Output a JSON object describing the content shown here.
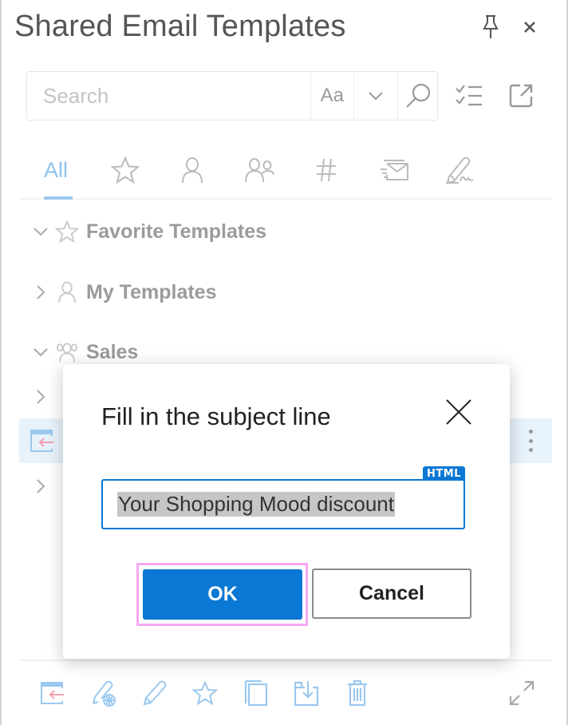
{
  "header": {
    "title": "Shared Email Templates",
    "pin_icon": "pin-icon",
    "close_icon": "close-icon"
  },
  "search": {
    "placeholder": "Search",
    "value": "",
    "match_case_label": "Aa",
    "dropdown_icon": "chevron-down-icon",
    "search_icon": "search-icon"
  },
  "toolbar": {
    "select_icon": "checklist-icon",
    "popout_icon": "open-external-icon"
  },
  "tabs": [
    {
      "id": "all",
      "label": "All",
      "active": true
    },
    {
      "id": "favorites",
      "icon": "star-icon"
    },
    {
      "id": "my",
      "icon": "person-icon"
    },
    {
      "id": "shared",
      "icon": "people-icon"
    },
    {
      "id": "hashtags",
      "icon": "hash-icon"
    },
    {
      "id": "email",
      "icon": "send-email-icon"
    },
    {
      "id": "signatures",
      "icon": "signature-pen-icon"
    }
  ],
  "tree": [
    {
      "label": "Favorite Templates",
      "expanded": true,
      "icon": "star-icon"
    },
    {
      "label": "My Templates",
      "expanded": false,
      "icon": "person-icon"
    },
    {
      "label": "Sales",
      "expanded": true,
      "icon": "people-icon"
    }
  ],
  "dialog": {
    "title": "Fill in the subject line",
    "badge": "HTML",
    "subject_value": "Your Shopping Mood discount",
    "ok_label": "OK",
    "cancel_label": "Cancel"
  },
  "bottom_toolbar": [
    {
      "id": "insert",
      "icon": "insert-template-icon"
    },
    {
      "id": "edit-web",
      "icon": "edit-web-icon"
    },
    {
      "id": "edit",
      "icon": "pencil-icon"
    },
    {
      "id": "favorite",
      "icon": "star-icon"
    },
    {
      "id": "copy",
      "icon": "copy-icon"
    },
    {
      "id": "move",
      "icon": "move-icon"
    },
    {
      "id": "delete",
      "icon": "trash-icon"
    },
    {
      "id": "expand",
      "icon": "expand-icon"
    }
  ],
  "colors": {
    "accent": "#0a78d4",
    "tab_active": "#8ec2ee",
    "icon_blue": "#9ac8ef",
    "icon_pink": "#f59fb0",
    "focus_ring": "#f6a8f2",
    "selected_row": "#e8f2fb"
  }
}
